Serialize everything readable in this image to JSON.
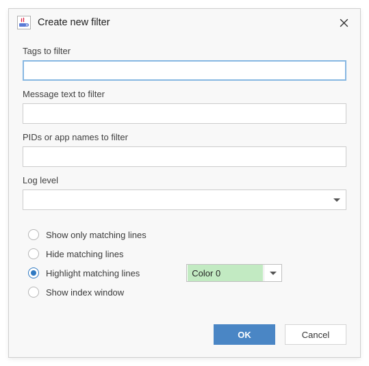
{
  "dialog": {
    "title": "Create new filter"
  },
  "fields": {
    "tags_label": "Tags to filter",
    "tags_value": "",
    "message_label": "Message text to filter",
    "message_value": "",
    "pids_label": "PIDs or app names to filter",
    "pids_value": "",
    "loglevel_label": "Log level",
    "loglevel_value": ""
  },
  "radios": {
    "show_only": "Show only matching lines",
    "hide": "Hide matching lines",
    "highlight": "Highlight matching lines",
    "index_window": "Show index window",
    "selected": "highlight"
  },
  "color_select": {
    "label": "Color 0",
    "swatch": "#c2eac2"
  },
  "buttons": {
    "ok": "OK",
    "cancel": "Cancel"
  }
}
